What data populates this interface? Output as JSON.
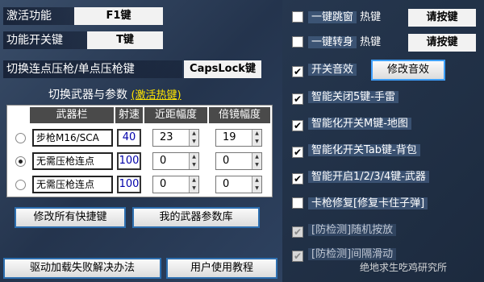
{
  "left": {
    "activate_label": "激活功能",
    "activate_key": "F1键",
    "toggle_label": "功能开关键",
    "toggle_key": "T键",
    "mode_label": "切换连点压枪/单点压枪键",
    "mode_key": "CapsLock键",
    "section_title": "切换武器与参数",
    "section_hot": "(激活热键)",
    "headers": [
      "武器栏",
      "射速",
      "近距幅度",
      "倍镜幅度"
    ],
    "rows": [
      {
        "selected": false,
        "weapon": "步枪M16/SCA",
        "rate": "40",
        "near": "23",
        "scope": "19"
      },
      {
        "selected": true,
        "weapon": "无需压枪连点",
        "rate": "100",
        "near": "0",
        "scope": "0"
      },
      {
        "selected": false,
        "weapon": "无需压枪连点",
        "rate": "100",
        "near": "0",
        "scope": "0"
      }
    ],
    "btn_edit_all": "修改所有快捷键",
    "btn_my_params": "我的武器参数库",
    "btn_driver": "驱动加载失败解决办法",
    "btn_tutorial": "用户使用教程"
  },
  "right": {
    "hotkey_label": "热键",
    "hotkey_placeholder": "请按键",
    "skip_window": "一键跳窗",
    "turn_around": "一键转身",
    "sound_toggle": "开关音效",
    "edit_sound": "修改音效",
    "smart_items": [
      {
        "label": "智能关闭5键-手雷",
        "checked": true
      },
      {
        "label": "智能化开关M键-地图",
        "checked": true
      },
      {
        "label": "智能化开关Tab键-背包",
        "checked": true
      },
      {
        "label": "智能开启1/2/3/4键-武器",
        "checked": true
      },
      {
        "label": "卡枪修复[修复卡住子弹]",
        "checked": false
      }
    ],
    "anti_detect": [
      {
        "label": "[防检测]随机按放",
        "checked": true
      },
      {
        "label": "[防检测]间隔滑动",
        "checked": true
      }
    ]
  },
  "watermark": "绝地求生吃鸡研究所"
}
